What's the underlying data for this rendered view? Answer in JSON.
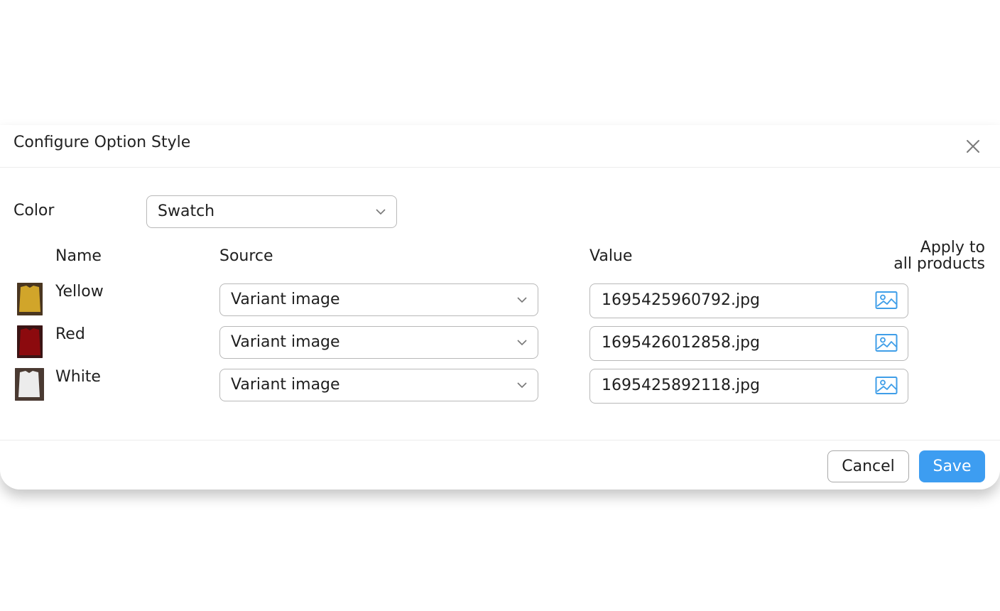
{
  "dialog": {
    "title": "Configure Option Style",
    "close_icon": "close-icon"
  },
  "option": {
    "label": "Color",
    "style_value": "Swatch"
  },
  "table": {
    "headers": {
      "name": "Name",
      "source": "Source",
      "value": "Value",
      "apply_line1": "Apply to",
      "apply_line2": "all products"
    },
    "rows": [
      {
        "name": "Yellow",
        "thumb_color": "#d1a52a",
        "source": "Variant image",
        "value": "1695425960792.jpg",
        "value_icon": "image-icon"
      },
      {
        "name": "Red",
        "thumb_color": "#8c0a0e",
        "source": "Variant image",
        "value": "1695426012858.jpg",
        "value_icon": "image-icon"
      },
      {
        "name": "White",
        "thumb_color": "#ececec",
        "source": "Variant image",
        "value": "1695425892118.jpg",
        "value_icon": "image-icon"
      }
    ]
  },
  "footer": {
    "cancel_label": "Cancel",
    "save_label": "Save"
  },
  "colors": {
    "accent": "#3d9df1",
    "border": "#b8b8b8",
    "icon_blue": "#3f9ee8"
  }
}
